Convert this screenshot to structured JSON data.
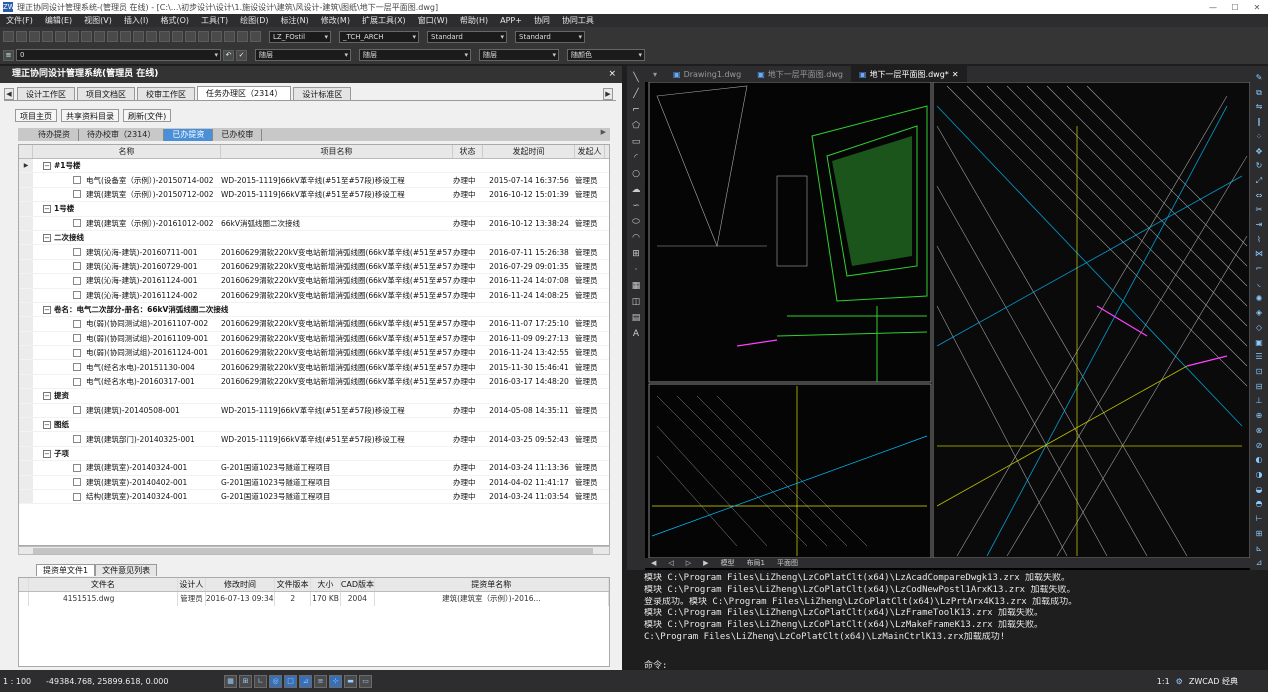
{
  "window": {
    "title": "理正协同设计管理系统-(管理员 在线) - [C:\\...\\初步设计\\设计\\1.施设设计\\建筑\\风设计-建筑\\图纸\\地下一层平面图.dwg]",
    "app_icon": "ZW",
    "minimize": "—",
    "maximize": "☐",
    "close": "✕"
  },
  "menu": [
    "文件(F)",
    "编辑(E)",
    "视图(V)",
    "插入(I)",
    "格式(O)",
    "工具(T)",
    "绘图(D)",
    "标注(N)",
    "修改(M)",
    "扩展工具(X)",
    "窗口(W)",
    "帮助(H)",
    "APP+",
    "协同",
    "协同工具"
  ],
  "toolbar": {
    "text_style": "LZ_FOstil",
    "dim_style": "_TCH_ARCH",
    "table_style": "Standard",
    "multileader_style": "Standard",
    "layer_value": "0",
    "color": "随层",
    "linetype": "随层",
    "lineweight": "随层",
    "plotstyle": "随颜色"
  },
  "panel": {
    "title": "理正协同设计管理系统(管理员 在线)",
    "close": "×",
    "tabs": [
      {
        "label": "设计工作区",
        "active": false
      },
      {
        "label": "项目文档区",
        "active": false
      },
      {
        "label": "校审工作区",
        "active": false
      },
      {
        "label": "任务办理区（2314）",
        "active": true
      },
      {
        "label": "设计标准区",
        "active": false
      }
    ],
    "buttons": [
      "项目主页",
      "共享资料目录",
      "刷新(文件)"
    ],
    "subtabs": [
      {
        "label": "待办提资",
        "active": false
      },
      {
        "label": "待办校审（2314）",
        "active": false
      },
      {
        "label": "已办提资",
        "active": true
      },
      {
        "label": "已办校审",
        "active": false
      }
    ],
    "columns": {
      "name": "名称",
      "project": "项目名称",
      "status": "状态",
      "time": "发起时间",
      "user": "发起人"
    },
    "rows": [
      {
        "type": "group",
        "name": "#1号楼"
      },
      {
        "type": "item",
        "name": "电气(设备室（示例）)-20150714-002",
        "project": "WD-2015-1119]66kV革辛线(#51至#57段)移设工程",
        "status": "办理中",
        "time": "2015-07-14 16:37:56",
        "user": "管理员"
      },
      {
        "type": "item",
        "name": "建筑(建筑室（示例）)-20150712-002",
        "project": "WD-2015-1119]66kV革辛线(#51至#57段)移设工程",
        "status": "办理中",
        "time": "2016-10-12 15:01:39",
        "user": "管理员"
      },
      {
        "type": "group",
        "name": "1号楼"
      },
      {
        "type": "item",
        "name": "建筑(建筑室（示例）)-20161012-002",
        "project": "66kV消弧线圈二次接线",
        "status": "办理中",
        "time": "2016-10-12 13:38:24",
        "user": "管理员"
      },
      {
        "type": "group",
        "name": "二次接线"
      },
      {
        "type": "item",
        "name": "建筑(沁海-建筑)-20160711-001",
        "project": "20160629渭软220kV变电站新增消弧线圈(66kV革辛线(#51至#57...",
        "status": "办理中",
        "time": "2016-07-11 15:26:38",
        "user": "管理员"
      },
      {
        "type": "item",
        "name": "建筑(沁海-建筑)-20160729-001",
        "project": "20160629渭软220kV变电站新增消弧线圈(66kV革辛线(#51至#57...",
        "status": "办理中",
        "time": "2016-07-29 09:01:35",
        "user": "管理员"
      },
      {
        "type": "item",
        "name": "建筑(沁海-建筑)-20161124-001",
        "project": "20160629渭软220kV变电站新增消弧线圈(66kV革辛线(#51至#57...",
        "status": "办理中",
        "time": "2016-11-24 14:07:08",
        "user": "管理员"
      },
      {
        "type": "item",
        "name": "建筑(沁海-建筑)-20161124-002",
        "project": "20160629渭软220kV变电站新增消弧线圈(66kV革辛线(#51至#57...",
        "status": "办理中",
        "time": "2016-11-24 14:08:25",
        "user": "管理员"
      },
      {
        "type": "group",
        "name": "卷名：电气二次部分-册名：66kV消弧线圈二次接线"
      },
      {
        "type": "item",
        "name": "电(弱)(协同测试组)-20161107-002",
        "project": "20160629渭软220kV变电站新增消弧线圈(66kV革辛线(#51至#57...",
        "status": "办理中",
        "time": "2016-11-07 17:25:10",
        "user": "管理员"
      },
      {
        "type": "item",
        "name": "电(弱)(协同测试组)-20161109-001",
        "project": "20160629渭软220kV变电站新增消弧线圈(66kV革辛线(#51至#57...",
        "status": "办理中",
        "time": "2016-11-09 09:27:13",
        "user": "管理员"
      },
      {
        "type": "item",
        "name": "电(弱)(协同测试组)-20161124-001",
        "project": "20160629渭软220kV变电站新增消弧线圈(66kV革辛线(#51至#57...",
        "status": "办理中",
        "time": "2016-11-24 13:42:55",
        "user": "管理员"
      },
      {
        "type": "item",
        "name": "电气(经名水电)-20151130-004",
        "project": "20160629渭软220kV变电站新增消弧线圈(66kV革辛线(#51至#57...",
        "status": "办理中",
        "time": "2015-11-30 15:46:41",
        "user": "管理员"
      },
      {
        "type": "item",
        "name": "电气(经名水电)-20160317-001",
        "project": "20160629渭软220kV变电站新增消弧线圈(66kV革辛线(#51至#57...",
        "status": "办理中",
        "time": "2016-03-17 14:48:20",
        "user": "管理员"
      },
      {
        "type": "group",
        "name": "提资"
      },
      {
        "type": "item",
        "name": "建筑(建筑)-20140508-001",
        "project": "WD-2015-1119]66kV革辛线(#51至#57段)移设工程",
        "status": "办理中",
        "time": "2014-05-08 14:35:11",
        "user": "管理员"
      },
      {
        "type": "group",
        "name": "图纸"
      },
      {
        "type": "item",
        "name": "建筑(建筑部门)-20140325-001",
        "project": "WD-2015-1119]66kV革辛线(#51至#57段)移设工程",
        "status": "办理中",
        "time": "2014-03-25 09:52:43",
        "user": "管理员"
      },
      {
        "type": "group",
        "name": "子项"
      },
      {
        "type": "item",
        "name": "建筑(建筑室)-20140324-001",
        "project": "G-201国道1023号隧道工程项目",
        "status": "办理中",
        "time": "2014-03-24 11:13:36",
        "user": "管理员"
      },
      {
        "type": "item",
        "name": "建筑(建筑室)-20140402-001",
        "project": "G-201国道1023号隧道工程项目",
        "status": "办理中",
        "time": "2014-04-02 11:41:17",
        "user": "管理员"
      },
      {
        "type": "item",
        "name": "结构(建筑室)-20140324-001",
        "project": "G-201国道1023号隧道工程项目",
        "status": "办理中",
        "time": "2014-03-24 11:03:54",
        "user": "管理员"
      }
    ],
    "bottom_tabs": [
      {
        "label": "提资单文件1",
        "active": true
      },
      {
        "label": "文件意见列表",
        "active": false
      }
    ],
    "file_columns": [
      "文件名",
      "设计人",
      "修改时间",
      "文件版本",
      "大小",
      "CAD版本",
      "提资单名称"
    ],
    "files": [
      {
        "name": "4151515.dwg",
        "designer": "管理员",
        "modified": "2016-07-13 09:34:23",
        "version": "2",
        "size": "170 KB",
        "cad": "2004",
        "sheet": "建筑(建筑室（示例）)-2016..."
      }
    ]
  },
  "drawing": {
    "tabs": [
      {
        "label": "Drawing1.dwg",
        "active": false
      },
      {
        "label": "地下一层平面图.dwg",
        "active": false
      },
      {
        "label": "地下一层平面图.dwg*",
        "active": true
      }
    ],
    "layout_tabs": [
      "模型",
      "布局1",
      "平面图"
    ]
  },
  "command": {
    "lines": [
      "模块 C:\\Program Files\\LiZheng\\LzCoPlatClt(x64)\\LzAcadCompareDwgk13.zrx 加载失败。",
      "模块 C:\\Program Files\\LiZheng\\LzCoPlatClt(x64)\\LzCodNewPostl1ArxK13.zrx 加载失败。",
      "登录成功。模块 C:\\Program Files\\LiZheng\\LzCoPlatClt(x64)\\LzPrtArx4K13.zrx 加载成功。",
      "模块 C:\\Program Files\\LiZheng\\LzCoPlatClt(x64)\\LzFrameToolK13.zrx 加载失败。",
      "模块 C:\\Program Files\\LiZheng\\LzCoPlatClt(x64)\\LzMakeFrameK13.zrx 加载失败。",
      "C:\\Program Files\\LiZheng\\LzCoPlatClt(x64)\\LzMainCtrlK13.zrx加载成功!"
    ],
    "prompt": "命令:"
  },
  "status": {
    "scale": "1 : 100",
    "coords": "-49384.768, 25899.618, 0.000",
    "annot_scale": "1:1",
    "brand": "ZWCAD 经典"
  },
  "colors": {
    "panel_bg": "#f0f0f0",
    "active_subtab": "#4a90d9",
    "canvas": "#000000"
  }
}
